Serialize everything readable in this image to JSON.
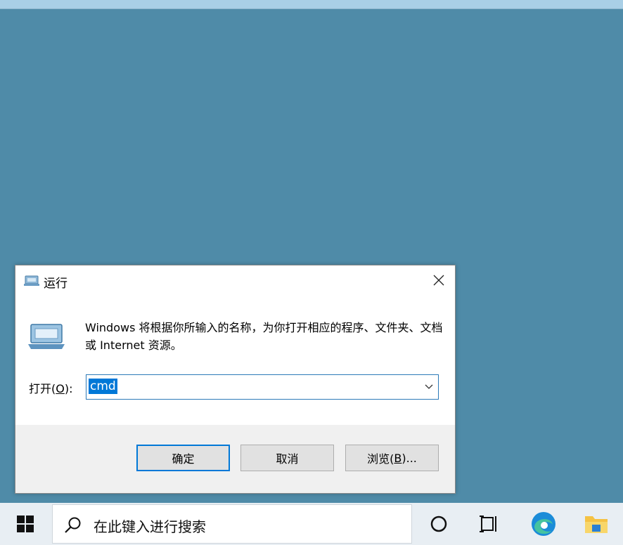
{
  "dialog": {
    "title": "运行",
    "description": "Windows 将根据你所输入的名称，为你打开相应的程序、文件夹、文档或 Internet 资源。",
    "open_label_prefix": "打开(",
    "open_label_key": "O",
    "open_label_suffix": "):",
    "command_value": "cmd",
    "ok_label": "确定",
    "cancel_label": "取消",
    "browse_prefix": "浏览(",
    "browse_key": "B",
    "browse_suffix": ")..."
  },
  "taskbar": {
    "search_placeholder": "在此键入进行搜索"
  },
  "colors": {
    "desktop": "#4f8ba8",
    "accent": "#0078d7",
    "taskbar": "#e8eef3"
  },
  "icons": [
    "run-icon",
    "close-icon",
    "chevron-down-icon",
    "windows-start-icon",
    "search-icon",
    "cortana-icon",
    "task-view-icon",
    "edge-icon",
    "file-explorer-icon"
  ]
}
